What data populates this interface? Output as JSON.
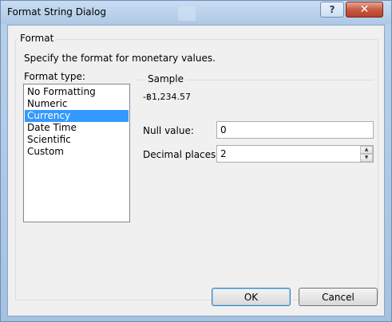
{
  "window": {
    "title": "Format String Dialog",
    "help_glyph": "?",
    "close_glyph": "✕"
  },
  "group": {
    "legend": "Format",
    "description": "Specify the format for monetary values."
  },
  "format_type": {
    "label": "Format type:",
    "items": [
      "No Formatting",
      "Numeric",
      "Currency",
      "Date Time",
      "Scientific",
      "Custom"
    ],
    "selected": "Currency"
  },
  "sample": {
    "legend": "Sample",
    "value": "-฿1,234.57"
  },
  "null_value": {
    "label": "Null value:",
    "value": "0"
  },
  "decimal_places": {
    "label": "Decimal places",
    "value": "2",
    "up_glyph": "▲",
    "down_glyph": "▼"
  },
  "buttons": {
    "ok": "OK",
    "cancel": "Cancel"
  },
  "colors": {
    "selection": "#3399ff",
    "titlebar": "#b9d1ea",
    "close_button": "#c75b43"
  }
}
